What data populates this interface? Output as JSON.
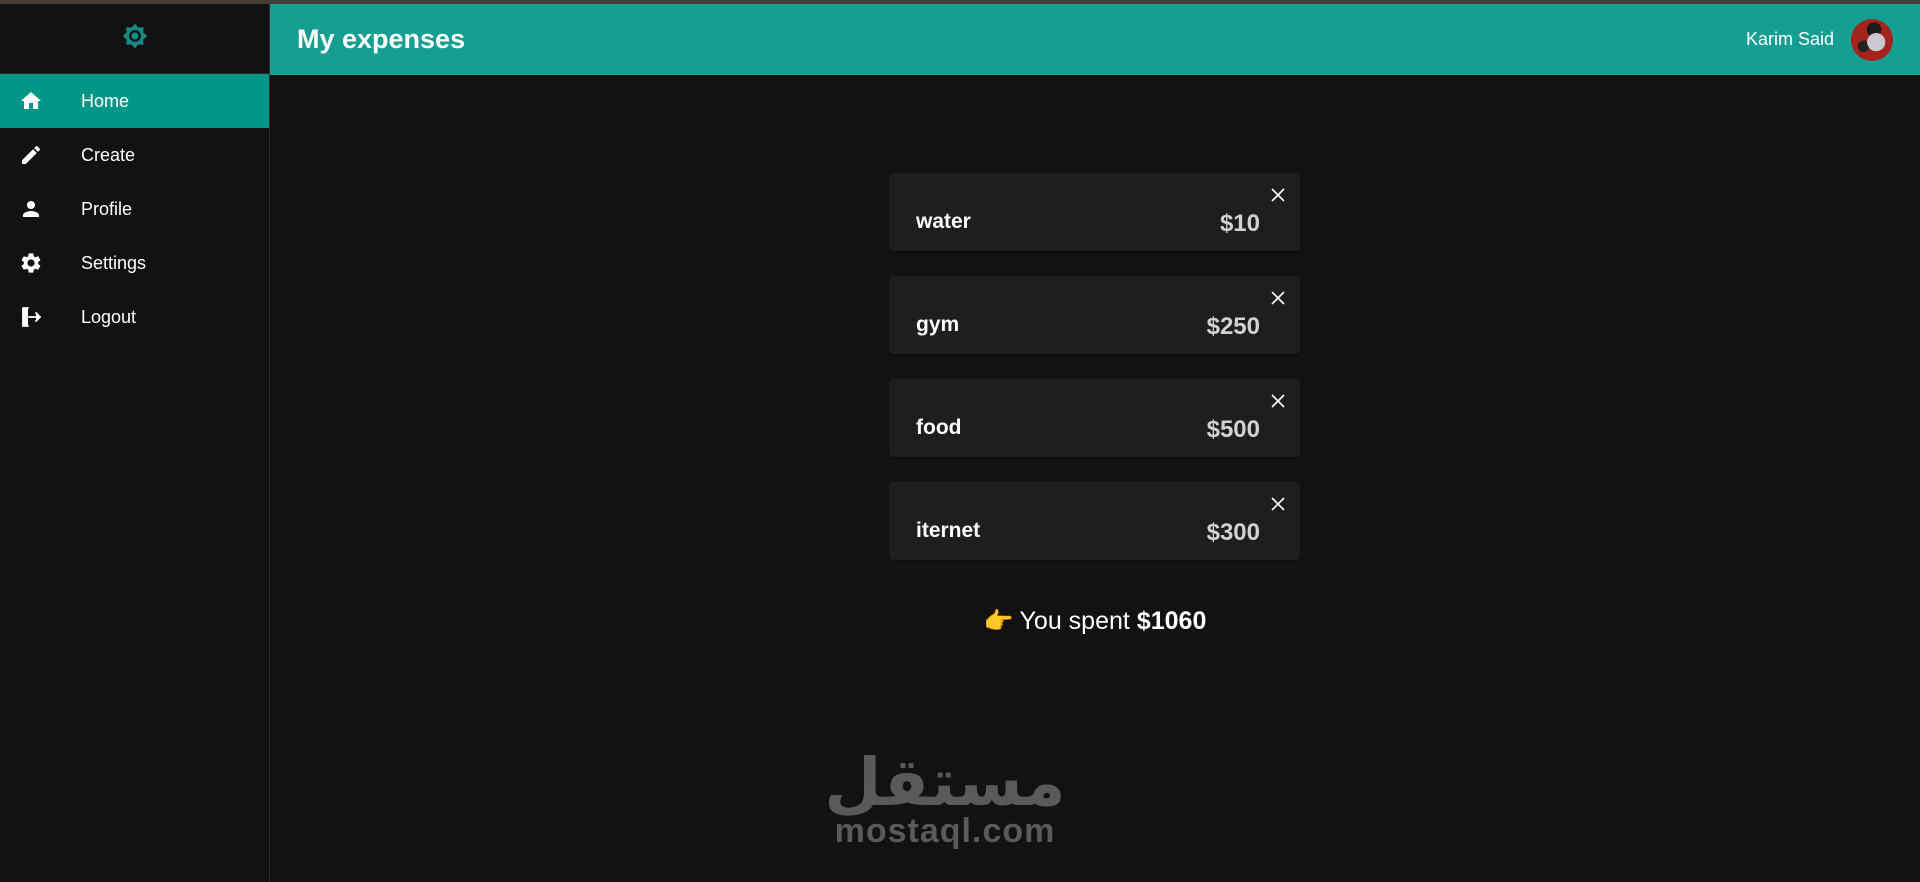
{
  "sidebar": {
    "header_icon": "brightness-icon",
    "items": [
      {
        "label": "Home",
        "icon": "home-icon",
        "active": true
      },
      {
        "label": "Create",
        "icon": "pencil-icon",
        "active": false
      },
      {
        "label": "Profile",
        "icon": "person-icon",
        "active": false
      },
      {
        "label": "Settings",
        "icon": "gear-icon",
        "active": false
      },
      {
        "label": "Logout",
        "icon": "logout-icon",
        "active": false
      }
    ]
  },
  "header": {
    "title": "My expenses",
    "user_name": "Karim Said",
    "avatar": "user-avatar"
  },
  "expenses": [
    {
      "name": "water",
      "amount": "$10"
    },
    {
      "name": "gym",
      "amount": "$250"
    },
    {
      "name": "food",
      "amount": "$500"
    },
    {
      "name": "iternet",
      "amount": "$300"
    }
  ],
  "summary": {
    "icon": "👉",
    "prefix": "You spent",
    "total": "$1060"
  },
  "watermark": {
    "arabic": "مستقل",
    "latin": "mostaql.com"
  },
  "colors": {
    "accent": "#009688",
    "header_bg": "#179e92",
    "page_bg": "#121212",
    "card_bg": "#1e1e1e"
  }
}
